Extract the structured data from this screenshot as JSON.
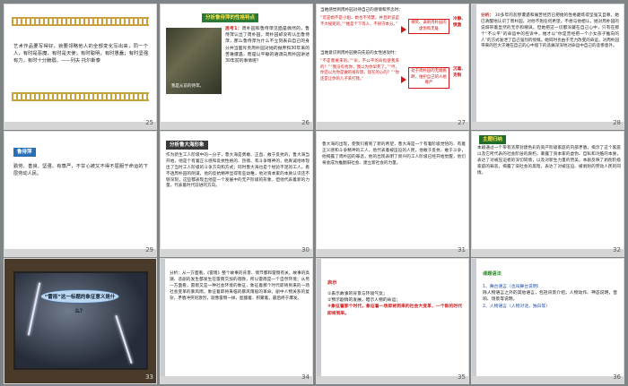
{
  "slides": [
    {
      "number": "25",
      "body": "艺术作品要写得好，就要领略他人的全部变化写出来，同一个人，有时是恶魔，有时是天使；有时聪明，有时愚蠢；有时坚强有力，有时十分脆弱。——列夫·托尔斯泰"
    },
    {
      "number": "26",
      "heading": "分析鲁侍萍的性格特点",
      "think_label": "思考1：",
      "think_text": "周朴园和鲁侍萍见面是偶然的，鲁侍萍认出了周朴园，周朴园却没有认出鲁侍萍，那么鲁侍萍为什么不立刻表白自己的身分并当面斥责周朴园对她的抛弃和30年来的苦难遭遇，而是以平静的语调向周朴园讲述30年前的事情呢？",
      "photo_caption": "我是从前的侍萍。"
    },
    {
      "number": "27",
      "line1": "当她感觉到周朴园对待自己的感情和怀念时：",
      "quote1": "“可是她不是小姐，她也不贤慧，并且听说是不大规矩的。”“她是个下等人，不很守本分。”",
      "box1": "嘲笑、讽刺周朴园的虚伪和无耻",
      "side1": "冷静、愤激",
      "line2": "当她意识到周朴园要向先前的女性进攻时：",
      "quote2": "“不是我要来的。”“命，不公平的命指使我来的！”“我没有找你，我以为你早死了。”“哼，你还以为你是做的很有理，现在的心的？”“你还是让你的儿子来打我。”",
      "box2": "处于周朴园的无端挑衅，维护自己的人格尊严",
      "side2": "沉着、克制"
    },
    {
      "number": "28",
      "label": "分析：",
      "text": "30多年的悲惨遭遇和痛苦经历已把她的性格磨炼得坚强又自尊。她已清醒地认识了周朴园。对他不抱任何希望。不想与他相认，她对周朴园的说辞带着显然的无奈和嘲讽。但她把这一切都深藏在自己心中，只有在那个“不公平”的命运中的控诉中，她才以“你是曾经把一个小女孩子推向的人”的方式发泄了自己强烈的愤慨。她同时也由于无力改变的命运，对周朴园带来的巨大灾难在自己的心中留下的悲痛深深地对命运中自己的悲惨意外。"
    },
    {
      "number": "29",
      "label": "鲁侍萍",
      "text": "勤劳、善良、坚强、有尊严，不甘心被又不得不屈服于命运的下层劳动人民。"
    },
    {
      "number": "30",
      "label": "分析鲁大海形象",
      "text": "作为新生工人阶级中的一分子，鲁大海是勇敢、正直、敢于反抗的，鲁大海当开始，他是个有着正义感和反抗性格的、热情、有斗争精神的，他真诚地体现出了当时工人阶级的斗争方向和方式；同时鲁大海也是个经验不足的工人，看不透周朴园的阴谋，他的反抗精神显得有些幼稚，他对资本家的本质认识还不够深刻，这些都表现出他是一个发展中的无产阶级的形象，但他代表着新的力量，代表着时代前进的方向。"
    },
    {
      "number": "31",
      "text": "鲁大海的出现，使我们看到了新的希望，鲁大海是一个有着阶级觉悟的、有着正义感和斗争精神的工人，他代表着被压迫的人民，他敢于反抗、敢于斗争，他揭露了周朴园的罪恶，他的出现表明了新兴的工人阶级已经开始觉醒，他们将会成为推翻旧社会、建立新社会的力量。"
    },
    {
      "number": "32",
      "label": "主题归纳",
      "text": "本剧通过一个带有浓厚封建色彩的资产阶级家庭的内部矛盾，揭示了这个家庭以及它所代表的社会阶层的腐朽，暴露了资本家的虚伪、自私和冷酷的本质，表达了对被压迫者的深切同情，以及对新生力量的赞美。本剧反映了剥削阶级家庭的罪恶，揭露了旧社会的黑暗，表达了对被压迫、被剥削的劳动人民的同情。"
    },
    {
      "number": "33",
      "bubble": "“雷雨”这一标题的象征意义是什么？"
    },
    {
      "number": "34",
      "label": "分析",
      "text": "分析：从一方面看，《雷雨》整个故事的背景、情节都和雷雨有关，故事的高潮、悲剧的发生都发生在雷雨交加的夜晚，所以雷雨是一个自然环境；从另一方面看，雷雨又是一种社会环境的象征，象征着那个时代即将到来的一场社会变革的暴风雨，象征着即将来临的暴风雨般的革命。剧中人物关系的复杂，矛盾冲突的激烈，就像雷雨一样，酝酿着、积聚着，最后终于爆发。"
    },
    {
      "number": "35",
      "label": "启示",
      "items": [
        "①表示故事的背景与环境气氛；",
        "②预示剧情的发展，暗示人物的命运；",
        "③象征着那个时代，象征着一场即将到来的社会大变革，一个新的时代即将到来。"
      ]
    },
    {
      "number": "36",
      "label": "课题语法",
      "items": [
        "1、舞台语言（也叫舞台说明）",
        "除人物语言之外的其他语言，包括背景介绍，人物动作、神态说明，音响、场景等说明。",
        "2、人物语言（人物对话，独白等）"
      ]
    }
  ]
}
